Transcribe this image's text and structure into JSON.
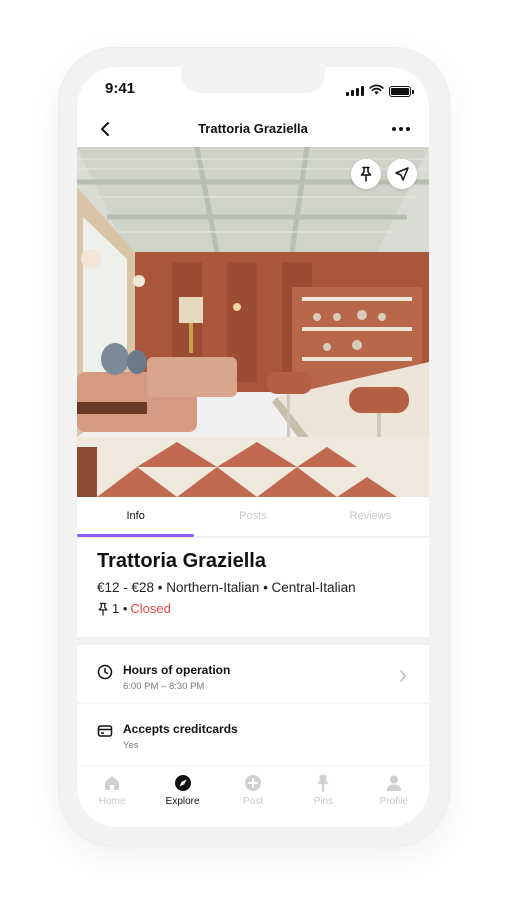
{
  "status_bar": {
    "time": "9:41"
  },
  "nav": {
    "title": "Trattoria Graziella"
  },
  "tabs": [
    {
      "label": "Info",
      "active": true
    },
    {
      "label": "Posts",
      "active": false
    },
    {
      "label": "Reviews",
      "active": false
    }
  ],
  "venue": {
    "name": "Trattoria Graziella",
    "meta": "€12 - €28 • Northern-Italian • Central-Italian",
    "pin_count": "1 •",
    "status": "Closed"
  },
  "details": [
    {
      "icon": "clock-icon",
      "title": "Hours of operation",
      "subtitle": "6:00 PM – 8:30 PM"
    },
    {
      "icon": "credit-card-icon",
      "title": "Accepts creditcards",
      "subtitle": "Yes"
    }
  ],
  "bottom_nav": [
    {
      "label": "Home",
      "icon": "home-icon",
      "active": false
    },
    {
      "label": "Explore",
      "icon": "compass-icon",
      "active": true
    },
    {
      "label": "Post",
      "icon": "plus-circle-icon",
      "active": false
    },
    {
      "label": "Pins",
      "icon": "pin-icon",
      "active": false
    },
    {
      "label": "Profile",
      "icon": "profile-icon",
      "active": false
    }
  ],
  "colors": {
    "accent": "#8b5cf6",
    "closed": "#ef4444",
    "inactive_label": "#c9c9c9"
  }
}
